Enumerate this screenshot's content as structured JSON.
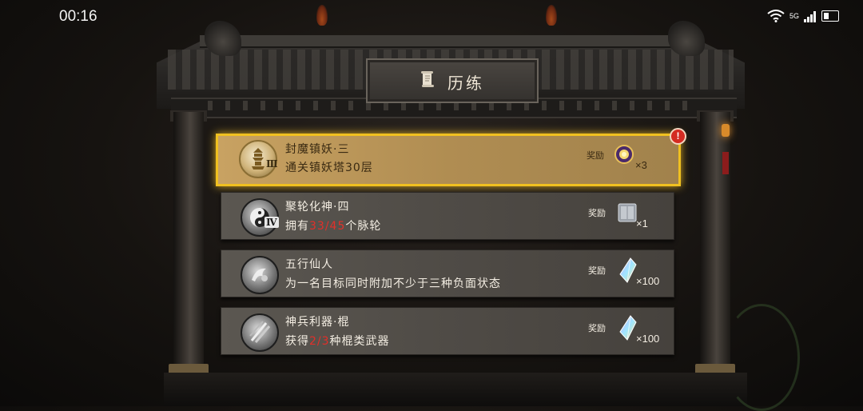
{
  "status_bar": {
    "time": "00:16",
    "network": "5G"
  },
  "title": "历练",
  "reward_label": "奖励",
  "quests": [
    {
      "title": "封魔镇妖·三",
      "desc_pre": "通关镇妖塔30层",
      "desc_highlight": "",
      "desc_post": "",
      "tier": "Ⅲ",
      "reward_icon": "purple-orb-icon",
      "reward_qty": "×3",
      "active": true,
      "alert": "!"
    },
    {
      "title": "聚轮化神·四",
      "desc_pre": "拥有",
      "desc_highlight": "33/45",
      "desc_post": "个脉轮",
      "tier": "Ⅳ",
      "reward_icon": "book-icon",
      "reward_qty": "×1",
      "active": false
    },
    {
      "title": "五行仙人",
      "desc_pre": "为一名目标同时附加不少于三种负面状态",
      "desc_highlight": "",
      "desc_post": "",
      "tier": "",
      "reward_icon": "crystal-icon",
      "reward_qty": "×100",
      "active": false
    },
    {
      "title": "神兵利器·棍",
      "desc_pre": "获得",
      "desc_highlight": "2/3",
      "desc_post": "种棍类武器",
      "tier": "",
      "reward_icon": "crystal-icon",
      "reward_qty": "×100",
      "active": false
    }
  ],
  "colors": {
    "active_border": "#f0c020",
    "highlight_text": "#e2302a"
  }
}
